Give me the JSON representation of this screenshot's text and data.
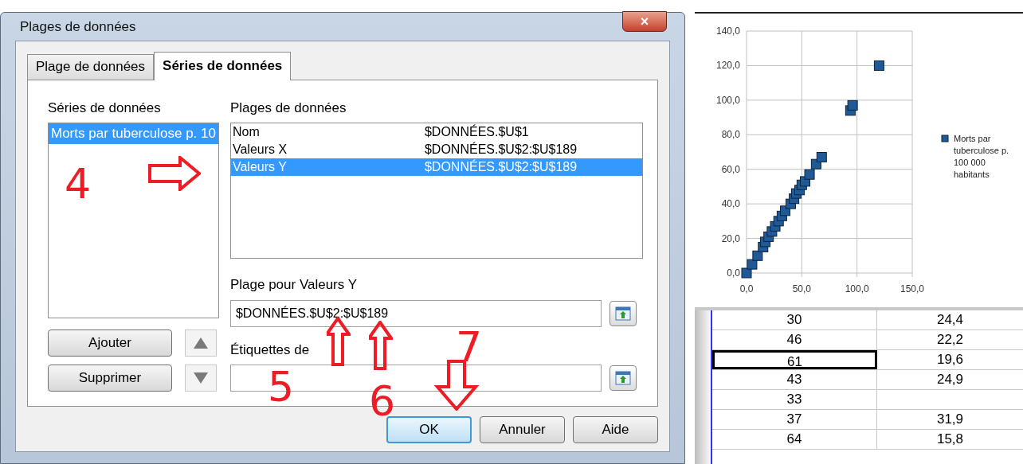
{
  "dialog": {
    "title": "Plages de données",
    "close": "×",
    "tabs": [
      {
        "label": "Plage de données",
        "selected": false
      },
      {
        "label": "Séries de données",
        "selected": true
      }
    ],
    "series_label": "Séries de données",
    "series": [
      {
        "name": "Morts par tuberculose p. 10",
        "selected": true
      }
    ],
    "ranges_label": "Plages de données",
    "ranges": [
      {
        "name": "Nom",
        "value": "$DONNÉES.$U$1",
        "selected": false
      },
      {
        "name": "Valeurs X",
        "value": "$DONNÉES.$U$2:$U$189",
        "selected": false
      },
      {
        "name": "Valeurs Y",
        "value": "$DONNÉES.$U$2:$U$189",
        "selected": true
      }
    ],
    "range_for_label": "Plage pour Valeurs Y",
    "range_for_value": "$DONNÉES.$U$2:$U$189",
    "labels_label": "Étiquettes de",
    "add_button": "Ajouter",
    "remove_button": "Supprimer",
    "up_disabled": false,
    "down_disabled": false,
    "buttons": [
      {
        "label": "OK",
        "default": true
      },
      {
        "label": "Annuler",
        "default": false
      },
      {
        "label": "Aide",
        "default": false
      }
    ]
  },
  "annotations": [
    {
      "label": "4",
      "kind": "number"
    },
    {
      "label": "5",
      "kind": "number"
    },
    {
      "label": "6",
      "kind": "number"
    },
    {
      "label": "7",
      "kind": "number"
    }
  ],
  "chart": {
    "chart_data": {
      "type": "scatter",
      "grid": true,
      "xlim": [
        0,
        150
      ],
      "ylim": [
        0,
        140
      ],
      "xticks": [
        {
          "value": 0,
          "label": "0,0"
        },
        {
          "value": 50,
          "label": "50,0"
        },
        {
          "value": 100,
          "label": "100,0"
        },
        {
          "value": 150,
          "label": "150,0"
        }
      ],
      "yticks": [
        {
          "value": 0,
          "label": "0,0"
        },
        {
          "value": 20,
          "label": "20,0"
        },
        {
          "value": 40,
          "label": "40,0"
        },
        {
          "value": 60,
          "label": "60,0"
        },
        {
          "value": 80,
          "label": "80,0"
        },
        {
          "value": 100,
          "label": "100,0"
        },
        {
          "value": 120,
          "label": "120,0"
        },
        {
          "value": 140,
          "label": "140,0"
        }
      ],
      "series": [
        {
          "name": "Morts par tuberculose p. 100 000 habitants",
          "color": "#1f5a96",
          "x": [
            0,
            5,
            10,
            15,
            17,
            20,
            23,
            26,
            29,
            32,
            35,
            40,
            43,
            45,
            48,
            50,
            53,
            57,
            63,
            68,
            94,
            96,
            120
          ],
          "values": [
            0,
            5,
            10,
            15,
            18,
            21,
            24,
            27,
            30,
            33,
            36,
            40,
            43,
            46,
            48,
            51,
            53,
            57,
            63,
            67,
            94,
            97,
            120
          ]
        }
      ]
    }
  },
  "sheet": {
    "rows": [
      {
        "a": "30",
        "b": "24,4",
        "selected": false
      },
      {
        "a": "46",
        "b": "22,2",
        "selected": false
      },
      {
        "a": "61",
        "b": "19,6",
        "selected": true
      },
      {
        "a": "43",
        "b": "24,9",
        "selected": false
      },
      {
        "a": "33",
        "b": "",
        "selected": false
      },
      {
        "a": "37",
        "b": "31,9",
        "selected": false
      },
      {
        "a": "64",
        "b": "15,8",
        "selected": false
      }
    ]
  }
}
